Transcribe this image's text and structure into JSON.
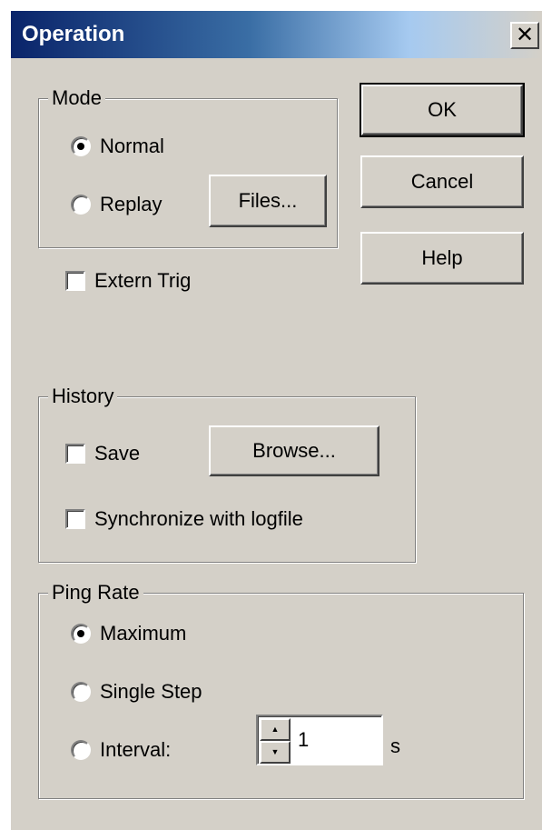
{
  "dialog": {
    "title": "Operation",
    "close_glyph": "✕"
  },
  "buttons": {
    "ok": "OK",
    "cancel": "Cancel",
    "help": "Help"
  },
  "mode": {
    "label": "Mode",
    "normal": "Normal",
    "replay": "Replay",
    "files_button": "Files...",
    "selected": "Normal"
  },
  "extern_trig": {
    "label": "Extern Trig",
    "checked": false
  },
  "history": {
    "label": "History",
    "save": "Save",
    "browse_button": "Browse...",
    "sync": "Synchronize with logfile",
    "save_checked": false,
    "sync_checked": false
  },
  "ping_rate": {
    "label": "Ping Rate",
    "maximum": "Maximum",
    "single_step": "Single Step",
    "interval": "Interval:",
    "interval_value": "1",
    "unit": "s",
    "selected": "Maximum"
  },
  "icons": {
    "spin_up": "▲",
    "spin_down": "▼"
  }
}
